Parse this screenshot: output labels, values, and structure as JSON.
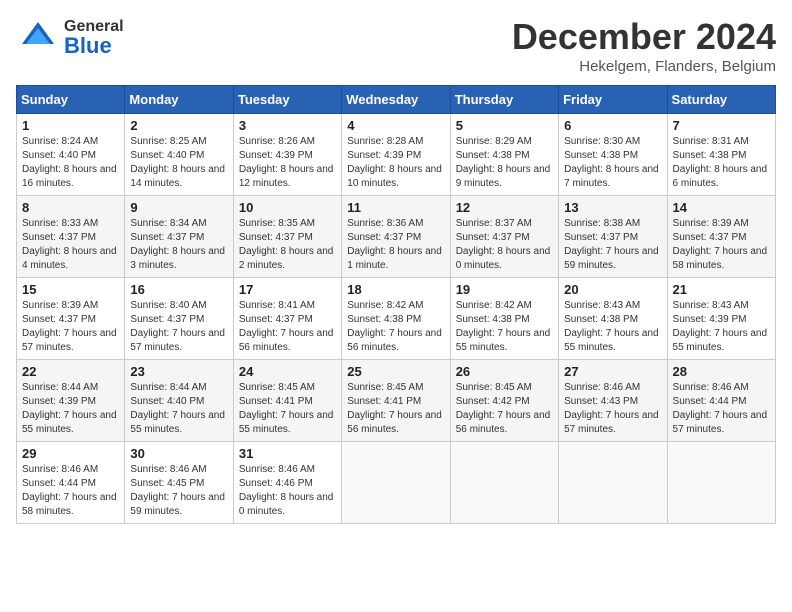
{
  "header": {
    "logo_general": "General",
    "logo_blue": "Blue",
    "month": "December 2024",
    "location": "Hekelgem, Flanders, Belgium"
  },
  "days_of_week": [
    "Sunday",
    "Monday",
    "Tuesday",
    "Wednesday",
    "Thursday",
    "Friday",
    "Saturday"
  ],
  "weeks": [
    [
      {
        "day": "1",
        "sunrise": "Sunrise: 8:24 AM",
        "sunset": "Sunset: 4:40 PM",
        "daylight": "Daylight: 8 hours and 16 minutes."
      },
      {
        "day": "2",
        "sunrise": "Sunrise: 8:25 AM",
        "sunset": "Sunset: 4:40 PM",
        "daylight": "Daylight: 8 hours and 14 minutes."
      },
      {
        "day": "3",
        "sunrise": "Sunrise: 8:26 AM",
        "sunset": "Sunset: 4:39 PM",
        "daylight": "Daylight: 8 hours and 12 minutes."
      },
      {
        "day": "4",
        "sunrise": "Sunrise: 8:28 AM",
        "sunset": "Sunset: 4:39 PM",
        "daylight": "Daylight: 8 hours and 10 minutes."
      },
      {
        "day": "5",
        "sunrise": "Sunrise: 8:29 AM",
        "sunset": "Sunset: 4:38 PM",
        "daylight": "Daylight: 8 hours and 9 minutes."
      },
      {
        "day": "6",
        "sunrise": "Sunrise: 8:30 AM",
        "sunset": "Sunset: 4:38 PM",
        "daylight": "Daylight: 8 hours and 7 minutes."
      },
      {
        "day": "7",
        "sunrise": "Sunrise: 8:31 AM",
        "sunset": "Sunset: 4:38 PM",
        "daylight": "Daylight: 8 hours and 6 minutes."
      }
    ],
    [
      {
        "day": "8",
        "sunrise": "Sunrise: 8:33 AM",
        "sunset": "Sunset: 4:37 PM",
        "daylight": "Daylight: 8 hours and 4 minutes."
      },
      {
        "day": "9",
        "sunrise": "Sunrise: 8:34 AM",
        "sunset": "Sunset: 4:37 PM",
        "daylight": "Daylight: 8 hours and 3 minutes."
      },
      {
        "day": "10",
        "sunrise": "Sunrise: 8:35 AM",
        "sunset": "Sunset: 4:37 PM",
        "daylight": "Daylight: 8 hours and 2 minutes."
      },
      {
        "day": "11",
        "sunrise": "Sunrise: 8:36 AM",
        "sunset": "Sunset: 4:37 PM",
        "daylight": "Daylight: 8 hours and 1 minute."
      },
      {
        "day": "12",
        "sunrise": "Sunrise: 8:37 AM",
        "sunset": "Sunset: 4:37 PM",
        "daylight": "Daylight: 8 hours and 0 minutes."
      },
      {
        "day": "13",
        "sunrise": "Sunrise: 8:38 AM",
        "sunset": "Sunset: 4:37 PM",
        "daylight": "Daylight: 7 hours and 59 minutes."
      },
      {
        "day": "14",
        "sunrise": "Sunrise: 8:39 AM",
        "sunset": "Sunset: 4:37 PM",
        "daylight": "Daylight: 7 hours and 58 minutes."
      }
    ],
    [
      {
        "day": "15",
        "sunrise": "Sunrise: 8:39 AM",
        "sunset": "Sunset: 4:37 PM",
        "daylight": "Daylight: 7 hours and 57 minutes."
      },
      {
        "day": "16",
        "sunrise": "Sunrise: 8:40 AM",
        "sunset": "Sunset: 4:37 PM",
        "daylight": "Daylight: 7 hours and 57 minutes."
      },
      {
        "day": "17",
        "sunrise": "Sunrise: 8:41 AM",
        "sunset": "Sunset: 4:37 PM",
        "daylight": "Daylight: 7 hours and 56 minutes."
      },
      {
        "day": "18",
        "sunrise": "Sunrise: 8:42 AM",
        "sunset": "Sunset: 4:38 PM",
        "daylight": "Daylight: 7 hours and 56 minutes."
      },
      {
        "day": "19",
        "sunrise": "Sunrise: 8:42 AM",
        "sunset": "Sunset: 4:38 PM",
        "daylight": "Daylight: 7 hours and 55 minutes."
      },
      {
        "day": "20",
        "sunrise": "Sunrise: 8:43 AM",
        "sunset": "Sunset: 4:38 PM",
        "daylight": "Daylight: 7 hours and 55 minutes."
      },
      {
        "day": "21",
        "sunrise": "Sunrise: 8:43 AM",
        "sunset": "Sunset: 4:39 PM",
        "daylight": "Daylight: 7 hours and 55 minutes."
      }
    ],
    [
      {
        "day": "22",
        "sunrise": "Sunrise: 8:44 AM",
        "sunset": "Sunset: 4:39 PM",
        "daylight": "Daylight: 7 hours and 55 minutes."
      },
      {
        "day": "23",
        "sunrise": "Sunrise: 8:44 AM",
        "sunset": "Sunset: 4:40 PM",
        "daylight": "Daylight: 7 hours and 55 minutes."
      },
      {
        "day": "24",
        "sunrise": "Sunrise: 8:45 AM",
        "sunset": "Sunset: 4:41 PM",
        "daylight": "Daylight: 7 hours and 55 minutes."
      },
      {
        "day": "25",
        "sunrise": "Sunrise: 8:45 AM",
        "sunset": "Sunset: 4:41 PM",
        "daylight": "Daylight: 7 hours and 56 minutes."
      },
      {
        "day": "26",
        "sunrise": "Sunrise: 8:45 AM",
        "sunset": "Sunset: 4:42 PM",
        "daylight": "Daylight: 7 hours and 56 minutes."
      },
      {
        "day": "27",
        "sunrise": "Sunrise: 8:46 AM",
        "sunset": "Sunset: 4:43 PM",
        "daylight": "Daylight: 7 hours and 57 minutes."
      },
      {
        "day": "28",
        "sunrise": "Sunrise: 8:46 AM",
        "sunset": "Sunset: 4:44 PM",
        "daylight": "Daylight: 7 hours and 57 minutes."
      }
    ],
    [
      {
        "day": "29",
        "sunrise": "Sunrise: 8:46 AM",
        "sunset": "Sunset: 4:44 PM",
        "daylight": "Daylight: 7 hours and 58 minutes."
      },
      {
        "day": "30",
        "sunrise": "Sunrise: 8:46 AM",
        "sunset": "Sunset: 4:45 PM",
        "daylight": "Daylight: 7 hours and 59 minutes."
      },
      {
        "day": "31",
        "sunrise": "Sunrise: 8:46 AM",
        "sunset": "Sunset: 4:46 PM",
        "daylight": "Daylight: 8 hours and 0 minutes."
      },
      null,
      null,
      null,
      null
    ]
  ]
}
